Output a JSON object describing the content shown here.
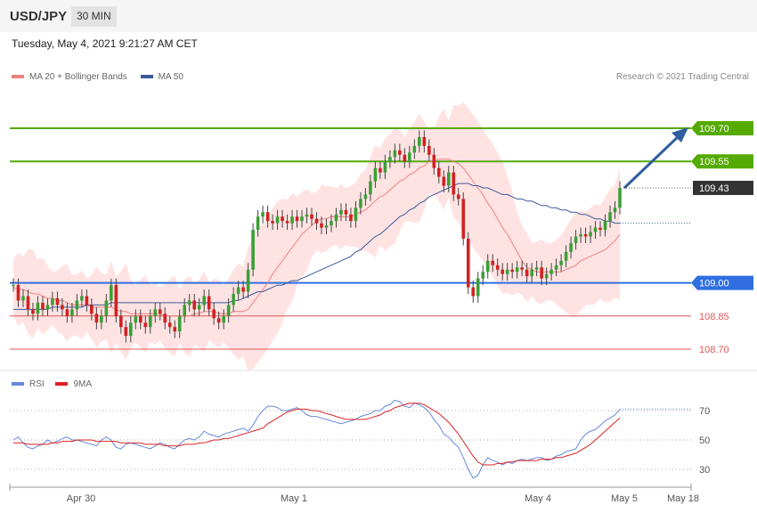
{
  "header": {
    "pair": "USD/JPY",
    "timeframe": "30 MIN"
  },
  "timestamp": "Tuesday, May 4, 2021 9:21:27 AM CET",
  "price_legend": {
    "ma20_bb": "MA 20 + Bollinger Bands",
    "ma50": "MA 50"
  },
  "credit": "Research © 2021 Trading Central",
  "rsi_legend": {
    "rsi": "RSI",
    "ma9": "9MA"
  },
  "colors": {
    "green_level": "#55aa00",
    "blue_level": "#2f6fe0",
    "red_level": "#e05555",
    "price_box": "#333333",
    "arrow": "#2e5e9e",
    "bollinger": "#ffd9d9",
    "ma20": "#f08080",
    "ma50": "#3a5a9a",
    "rsi": "#6688dd",
    "rsi_ma": "#dd2222",
    "candle_up": "#3aa035",
    "candle_down": "#d42020"
  },
  "chart_data": [
    {
      "type": "line",
      "title": "USD/JPY 30 MIN",
      "y_range": [
        108.6,
        109.85
      ],
      "x_labels": [
        "Apr 30",
        "May 1",
        "May 4",
        "May 5",
        "May 18"
      ],
      "levels": [
        {
          "label": "109.70",
          "value": 109.7,
          "kind": "resistance"
        },
        {
          "label": "109.55",
          "value": 109.55,
          "kind": "resistance"
        },
        {
          "label": "109.43",
          "value": 109.43,
          "kind": "last"
        },
        {
          "label": "109.00",
          "value": 109.0,
          "kind": "pivot"
        },
        {
          "label": "108.85",
          "value": 108.85,
          "kind": "support"
        },
        {
          "label": "108.70",
          "value": 108.7,
          "kind": "support"
        }
      ],
      "closes": [
        108.99,
        108.92,
        108.94,
        108.88,
        108.86,
        108.91,
        108.88,
        108.9,
        108.93,
        108.9,
        108.88,
        108.85,
        108.88,
        108.92,
        108.94,
        108.9,
        108.86,
        108.82,
        108.85,
        108.92,
        108.99,
        108.85,
        108.8,
        108.76,
        108.82,
        108.85,
        108.82,
        108.8,
        108.85,
        108.88,
        108.86,
        108.82,
        108.8,
        108.78,
        108.85,
        108.9,
        108.92,
        108.88,
        108.9,
        108.94,
        108.88,
        108.84,
        108.82,
        108.85,
        108.9,
        108.95,
        108.98,
        108.96,
        109.06,
        109.24,
        109.3,
        109.32,
        109.28,
        109.27,
        109.3,
        109.28,
        109.27,
        109.3,
        109.28,
        109.3,
        109.31,
        109.29,
        109.27,
        109.25,
        109.26,
        109.28,
        109.31,
        109.33,
        109.31,
        109.28,
        109.34,
        109.38,
        109.4,
        109.46,
        109.52,
        109.5,
        109.55,
        109.57,
        109.6,
        109.58,
        109.55,
        109.59,
        109.62,
        109.66,
        109.62,
        109.58,
        109.52,
        109.48,
        109.44,
        109.5,
        109.4,
        109.38,
        109.2,
        108.98,
        108.94,
        109.02,
        109.05,
        109.1,
        109.08,
        109.06,
        109.04,
        109.06,
        109.05,
        109.07,
        109.06,
        109.03,
        109.06,
        109.07,
        109.02,
        109.04,
        109.06,
        109.08,
        109.1,
        109.14,
        109.18,
        109.21,
        109.22,
        109.21,
        109.23,
        109.25,
        109.24,
        109.28,
        109.32,
        109.34,
        109.43
      ],
      "ma20": [
        108.98,
        108.97,
        108.97,
        108.96,
        108.95,
        108.95,
        108.94,
        108.93,
        108.93,
        108.92,
        108.92,
        108.91,
        108.9,
        108.9,
        108.9,
        108.9,
        108.89,
        108.89,
        108.89,
        108.89,
        108.89,
        108.88,
        108.87,
        108.87,
        108.86,
        108.86,
        108.86,
        108.86,
        108.86,
        108.86,
        108.86,
        108.85,
        108.85,
        108.85,
        108.85,
        108.85,
        108.85,
        108.86,
        108.86,
        108.87,
        108.87,
        108.87,
        108.86,
        108.86,
        108.86,
        108.87,
        108.87,
        108.87,
        108.88,
        108.91,
        108.94,
        108.97,
        109.0,
        109.04,
        109.07,
        109.1,
        109.13,
        109.16,
        109.19,
        109.22,
        109.24,
        109.26,
        109.28,
        109.29,
        109.29,
        109.3,
        109.3,
        109.3,
        109.3,
        109.3,
        109.31,
        109.32,
        109.33,
        109.35,
        109.37,
        109.39,
        109.4,
        109.42,
        109.44,
        109.46,
        109.47,
        109.49,
        109.5,
        109.52,
        109.53,
        109.55,
        109.55,
        109.56,
        109.56,
        109.56,
        109.55,
        109.54,
        109.52,
        109.49,
        109.46,
        109.43,
        109.4,
        109.36,
        109.33,
        109.29,
        109.25,
        109.22,
        109.18,
        109.14,
        109.1,
        109.07,
        109.06,
        109.05,
        109.05,
        109.05,
        109.05,
        109.05,
        109.05,
        109.06,
        109.07,
        109.08,
        109.1,
        109.11,
        109.12,
        109.13,
        109.14,
        109.15,
        109.17,
        109.19,
        109.22
      ],
      "ma50": [
        108.88,
        108.88,
        108.88,
        108.88,
        108.88,
        108.88,
        108.88,
        108.88,
        108.89,
        108.89,
        108.89,
        108.89,
        108.89,
        108.89,
        108.89,
        108.9,
        108.9,
        108.9,
        108.9,
        108.9,
        108.91,
        108.91,
        108.91,
        108.91,
        108.91,
        108.91,
        108.91,
        108.91,
        108.91,
        108.91,
        108.91,
        108.91,
        108.91,
        108.91,
        108.91,
        108.91,
        108.91,
        108.91,
        108.91,
        108.91,
        108.91,
        108.91,
        108.91,
        108.91,
        108.91,
        108.92,
        108.92,
        108.93,
        108.94,
        108.95,
        108.96,
        108.96,
        108.97,
        108.98,
        108.99,
        108.99,
        109.0,
        109.01,
        109.01,
        109.02,
        109.03,
        109.04,
        109.05,
        109.06,
        109.07,
        109.08,
        109.09,
        109.1,
        109.11,
        109.12,
        109.14,
        109.15,
        109.17,
        109.19,
        109.21,
        109.22,
        109.24,
        109.26,
        109.28,
        109.3,
        109.31,
        109.33,
        109.34,
        109.36,
        109.37,
        109.39,
        109.4,
        109.41,
        109.42,
        109.43,
        109.44,
        109.45,
        109.45,
        109.45,
        109.44,
        109.44,
        109.43,
        109.43,
        109.42,
        109.41,
        109.4,
        109.4,
        109.39,
        109.38,
        109.38,
        109.37,
        109.37,
        109.36,
        109.35,
        109.35,
        109.34,
        109.34,
        109.33,
        109.33,
        109.32,
        109.32,
        109.31,
        109.31,
        109.3,
        109.29,
        109.29,
        109.28,
        109.28,
        109.27,
        109.27
      ]
    },
    {
      "type": "line",
      "title": "RSI",
      "y_range": [
        20,
        85
      ],
      "y_ticks": [
        30,
        50,
        70
      ],
      "rsi": [
        50,
        52,
        48,
        45,
        44,
        46,
        47,
        50,
        48,
        49,
        51,
        52,
        50,
        50,
        49,
        48,
        47,
        46,
        50,
        52,
        50,
        45,
        44,
        47,
        48,
        47,
        46,
        45,
        44,
        46,
        48,
        47,
        45,
        44,
        47,
        50,
        51,
        50,
        52,
        56,
        54,
        53,
        52,
        54,
        55,
        56,
        57,
        58,
        56,
        60,
        66,
        70,
        73,
        73,
        72,
        70,
        70,
        71,
        72,
        70,
        67,
        66,
        66,
        65,
        64,
        63,
        62,
        61,
        62,
        63,
        64,
        66,
        67,
        68,
        70,
        70,
        73,
        74,
        77,
        76,
        73,
        72,
        75,
        74,
        72,
        69,
        64,
        60,
        54,
        52,
        48,
        45,
        38,
        30,
        24,
        26,
        33,
        38,
        36,
        35,
        33,
        35,
        34,
        36,
        37,
        36,
        37,
        38,
        38,
        36,
        37,
        39,
        40,
        42,
        43,
        44,
        50,
        54,
        56,
        57,
        60,
        63,
        65,
        67,
        71
      ],
      "rsi_ma": [
        48,
        48,
        48,
        47,
        47,
        47,
        47,
        47,
        48,
        48,
        49,
        49,
        49,
        50,
        50,
        50,
        50,
        49,
        49,
        49,
        49,
        49,
        48,
        48,
        48,
        48,
        48,
        47,
        47,
        47,
        47,
        46,
        46,
        46,
        46,
        47,
        47,
        47,
        48,
        48,
        49,
        50,
        50,
        51,
        51,
        52,
        53,
        54,
        55,
        56,
        57,
        58,
        61,
        63,
        65,
        67,
        69,
        70,
        71,
        71,
        71,
        70,
        70,
        69,
        68,
        67,
        66,
        65,
        64,
        64,
        64,
        64,
        64,
        65,
        66,
        67,
        69,
        70,
        72,
        73,
        74,
        75,
        75,
        75,
        74,
        72,
        70,
        68,
        65,
        62,
        58,
        54,
        49,
        44,
        39,
        35,
        33,
        33,
        33,
        34,
        34,
        35,
        35,
        36,
        36,
        36,
        36,
        36,
        37,
        37,
        37,
        38,
        38,
        39,
        40,
        41,
        43,
        45,
        47,
        50,
        53,
        56,
        59,
        62,
        65
      ]
    }
  ]
}
